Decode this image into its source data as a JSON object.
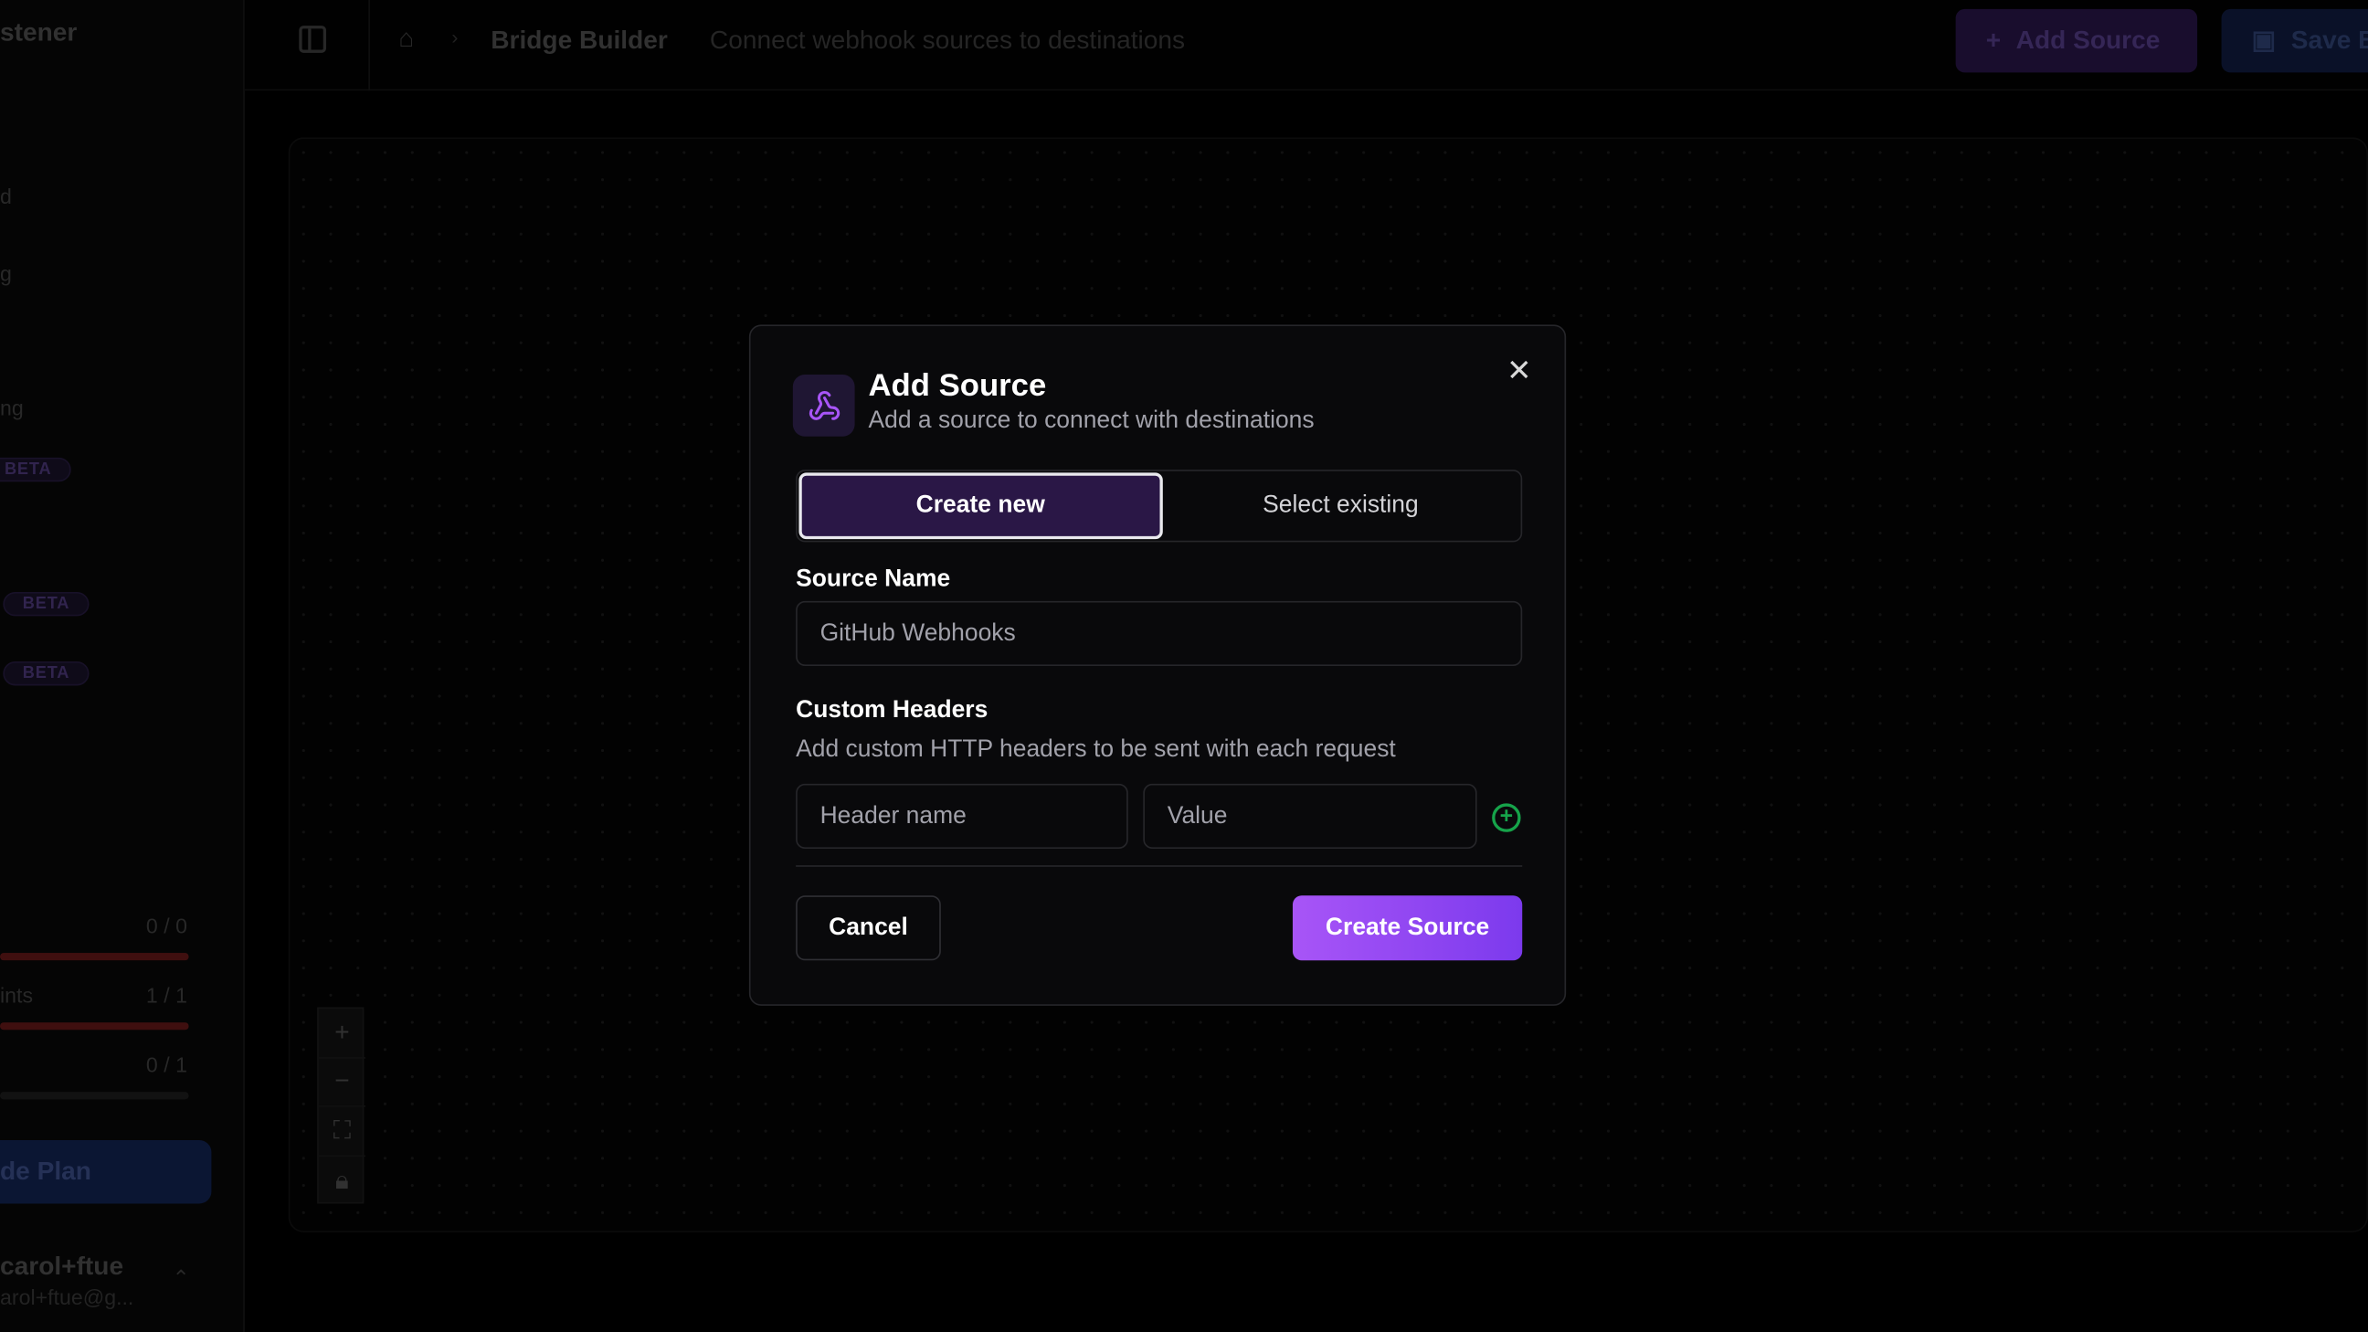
{
  "sidebar": {
    "app_title_fragment": "stener",
    "items": [
      {
        "label": "d"
      },
      {
        "label": "g"
      },
      {
        "label": "ng"
      }
    ],
    "beta_badges": [
      "BETA",
      "BETA",
      "BETA"
    ],
    "usage": [
      {
        "label": "",
        "value": "0 / 0",
        "fill": 1.0
      },
      {
        "label": "ints",
        "value": "1 / 1",
        "fill": 1.0
      },
      {
        "label": "",
        "value": "0 / 1",
        "fill": 0.0
      }
    ],
    "upgrade_label": "de Plan",
    "user": {
      "name": "carol+ftue",
      "email": "arol+ftue@g..."
    }
  },
  "topbar": {
    "breadcrumb_title": "Bridge Builder",
    "breadcrumb_subtitle": "Connect webhook sources to destinations",
    "add_source_label": "Add Source",
    "save_label": "Save B"
  },
  "modal": {
    "title": "Add Source",
    "description": "Add a source to connect with destinations",
    "tabs": [
      {
        "label": "Create new",
        "active": true
      },
      {
        "label": "Select existing",
        "active": false
      }
    ],
    "source_name_label": "Source Name",
    "source_name_value": "GitHub Webhooks",
    "custom_headers_label": "Custom Headers",
    "custom_headers_help": "Add custom HTTP headers to be sent with each request",
    "header_name_placeholder": "Header name",
    "header_value_placeholder": "Value",
    "cancel_label": "Cancel",
    "create_label": "Create Source"
  },
  "colors": {
    "accent": "#a855f7",
    "accent_dark": "#2a1746",
    "add_icon": "#16a34a"
  },
  "icons": {
    "webhook": "webhook-icon",
    "close": "close-icon",
    "home": "home-icon",
    "sidebar_toggle": "sidebar-toggle-icon",
    "plus": "plus-icon",
    "save": "save-icon",
    "add_circle": "add-circle-icon",
    "zoom_in": "zoom-in-icon",
    "zoom_out": "zoom-out-icon",
    "fit_view": "fit-view-icon",
    "lock": "lock-icon",
    "chevron": "chevron-up-down-icon"
  }
}
